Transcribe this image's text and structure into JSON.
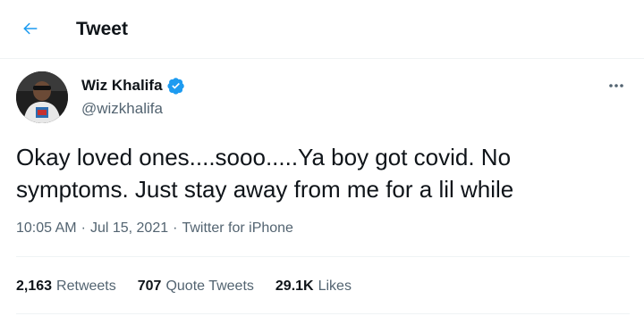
{
  "header": {
    "title": "Tweet",
    "back_icon": "arrow-left-icon"
  },
  "author": {
    "display_name": "Wiz Khalifa",
    "handle": "@wizkhalifa",
    "verified": true
  },
  "tweet": {
    "text": "Okay loved ones....sooo.....Ya boy got covid. No symptoms. Just stay away from me for a lil while",
    "time": "10:05 AM",
    "separator": "·",
    "date": "Jul 15, 2021",
    "source": "Twitter for iPhone"
  },
  "stats": {
    "retweets_count": "2,163",
    "retweets_label": "Retweets",
    "quotes_count": "707",
    "quotes_label": "Quote Tweets",
    "likes_count": "29.1K",
    "likes_label": "Likes"
  },
  "colors": {
    "accent": "#1d9bf0",
    "text_primary": "#0f1419",
    "text_secondary": "#536471",
    "divider": "#eff3f4"
  }
}
